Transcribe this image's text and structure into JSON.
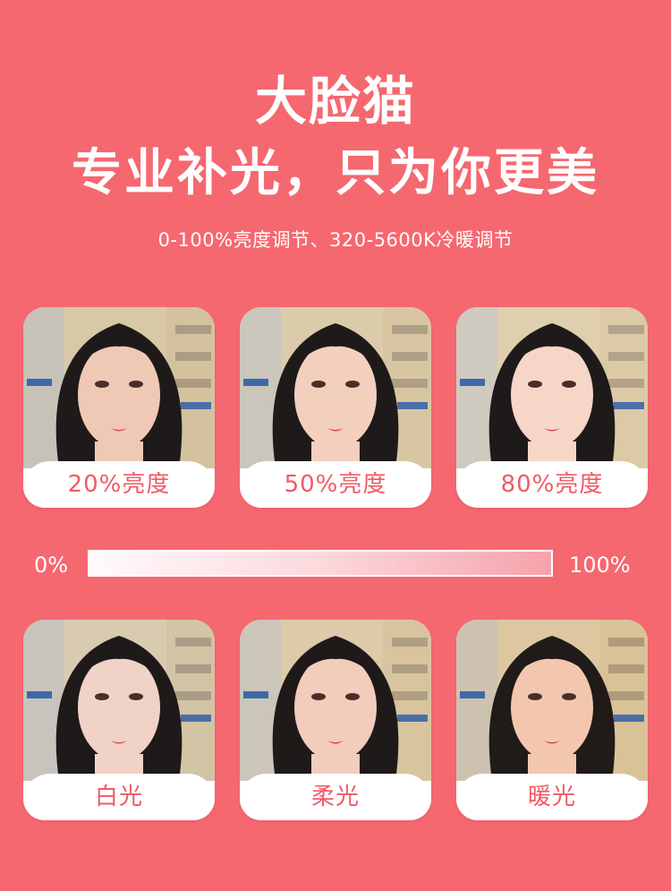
{
  "header": {
    "title": "大脸猫",
    "subtitle": "专业补光，只为你更美",
    "tagline": "0-100%亮度调节、320-5600K冷暖调节"
  },
  "brightness_samples": [
    {
      "label": "20%亮度"
    },
    {
      "label": "50%亮度"
    },
    {
      "label": "80%亮度"
    }
  ],
  "brightness_scale": {
    "min_label": "0%",
    "max_label": "100%"
  },
  "color_temperature_samples": [
    {
      "label": "白光"
    },
    {
      "label": "柔光"
    },
    {
      "label": "暖光"
    }
  ],
  "colors": {
    "background": "#f56870",
    "label_text": "#f05a66",
    "card": "#ffffff"
  }
}
